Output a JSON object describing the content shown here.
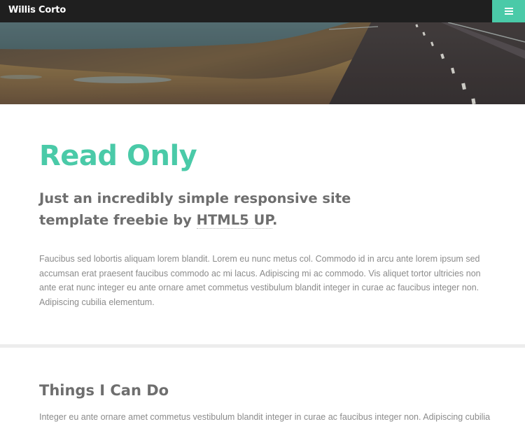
{
  "header": {
    "site_title": "Willis Corto",
    "menu_icon": "hamburger-menu-icon",
    "accent_color": "#4acaa8",
    "bar_color": "#1f1f1f"
  },
  "banner": {
    "description_icon": "road-landscape-photo"
  },
  "intro": {
    "title": "Read Only",
    "subtitle_before_link": "Just an incredibly simple responsive site template freebie by ",
    "subtitle_link": "HTML5 UP",
    "subtitle_after_link": ".",
    "paragraph": "Faucibus sed lobortis aliquam lorem blandit. Lorem eu nunc metus col. Commodo id in arcu ante lorem ipsum sed accumsan erat praesent faucibus commodo ac mi lacus. Adipiscing mi ac commodo. Vis aliquet tortor ultricies non ante erat nunc integer eu ante ornare amet commetus vestibulum blandit integer in curae ac faucibus integer non. Adipiscing cubilia elementum."
  },
  "skills": {
    "title": "Things I Can Do",
    "paragraph": "Integer eu ante ornare amet commetus vestibulum blandit integer in curae ac faucibus integer non. Adipiscing cubilia"
  }
}
